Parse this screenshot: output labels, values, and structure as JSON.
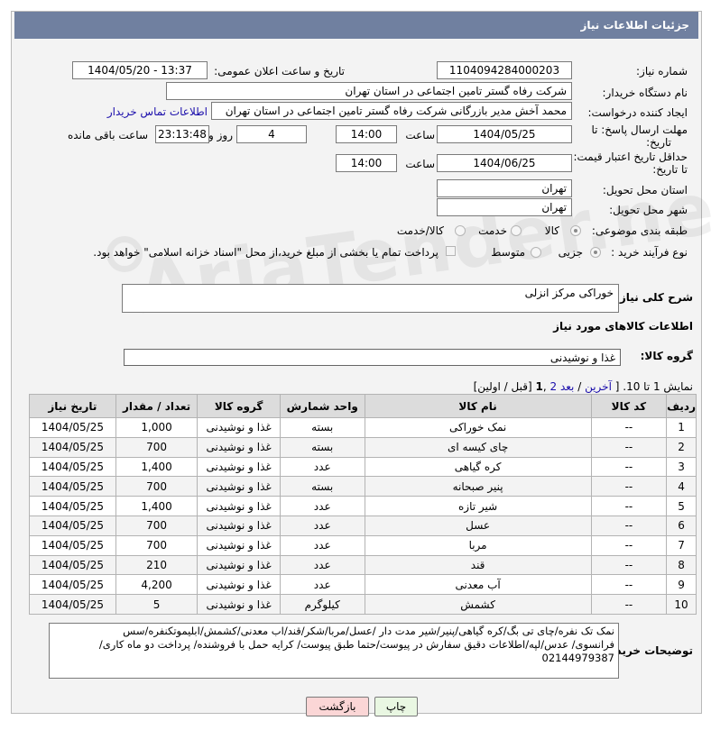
{
  "title": "جزئیات اطلاعات نیاز",
  "need_number": {
    "label": "شماره نیاز:",
    "value": "1104094284000203"
  },
  "announce": {
    "label": "تاریخ و ساعت اعلان عمومی:",
    "value": "1404/05/20 - 13:37"
  },
  "buyer_org": {
    "label": "نام دستگاه خریدار:",
    "value": "شرکت رفاه گستر تامین اجتماعی در استان تهران"
  },
  "creator": {
    "label": "ایجاد کننده درخواست:",
    "value": "محمد آخش مدیر بازرگانی شرکت رفاه گستر تامین اجتماعی در استان تهران",
    "contact_link": "اطلاعات تماس خریدار"
  },
  "deadline": {
    "label1": "مهلت ارسال پاسخ: تا",
    "label2": "تاریخ:",
    "date": "1404/05/25",
    "time_label": "ساعت",
    "time": "14:00",
    "days": "4",
    "days_label": "روز و",
    "remaining": "23:13:48",
    "remaining_label": "ساعت باقی مانده"
  },
  "validity": {
    "label1": "حداقل تاریخ اعتبار قیمت:",
    "label2": "تا تاریخ:",
    "date": "1404/06/25",
    "time_label": "ساعت",
    "time": "14:00"
  },
  "province": {
    "label": "استان محل تحویل:",
    "value": "تهران"
  },
  "city": {
    "label": "شهر محل تحویل:",
    "value": "تهران"
  },
  "category": {
    "label": "طبقه بندی موضوعی:",
    "options": [
      "کالا",
      "خدمت",
      "کالا/خدمت"
    ]
  },
  "process": {
    "label": "نوع فرآیند خرید :",
    "options": [
      "جزیی",
      "متوسط"
    ],
    "payment_note": "پرداخت تمام یا بخشی از مبلغ خرید،از محل \"اسناد خزانه اسلامی\" خواهد بود."
  },
  "summary": {
    "label": "شرح کلی نیاز:",
    "value": "خوراکی مرکز انزلی"
  },
  "goods_info_title": "اطلاعات کالاهای مورد نیاز",
  "goods_group": {
    "label": "گروه کالا:",
    "value": "غذا و نوشیدنی"
  },
  "pagination": {
    "text1": "نمایش 1 تا 10. [",
    "last": "آخرین",
    "sep1": " / ",
    "next": "بعد",
    "page2": "2",
    "page1": "1",
    "text2": "[قبل / اولین]"
  },
  "table": {
    "headers": [
      "ردیف",
      "کد کالا",
      "نام کالا",
      "واحد شمارش",
      "گروه کالا",
      "تعداد / مقدار",
      "تاریخ نیاز"
    ],
    "rows": [
      [
        "1",
        "--",
        "نمک خوراکی",
        "بسته",
        "غذا و نوشیدنی",
        "1,000",
        "1404/05/25"
      ],
      [
        "2",
        "--",
        "چای کیسه ای",
        "بسته",
        "غذا و نوشیدنی",
        "700",
        "1404/05/25"
      ],
      [
        "3",
        "--",
        "کره گیاهی",
        "عدد",
        "غذا و نوشیدنی",
        "1,400",
        "1404/05/25"
      ],
      [
        "4",
        "--",
        "پنیر صبحانه",
        "بسته",
        "غذا و نوشیدنی",
        "700",
        "1404/05/25"
      ],
      [
        "5",
        "--",
        "شیر تازه",
        "عدد",
        "غذا و نوشیدنی",
        "1,400",
        "1404/05/25"
      ],
      [
        "6",
        "--",
        "عسل",
        "عدد",
        "غذا و نوشیدنی",
        "700",
        "1404/05/25"
      ],
      [
        "7",
        "--",
        "مربا",
        "عدد",
        "غذا و نوشیدنی",
        "700",
        "1404/05/25"
      ],
      [
        "8",
        "--",
        "قند",
        "عدد",
        "غذا و نوشیدنی",
        "210",
        "1404/05/25"
      ],
      [
        "9",
        "--",
        "آب معدنی",
        "عدد",
        "غذا و نوشیدنی",
        "4,200",
        "1404/05/25"
      ],
      [
        "10",
        "--",
        "کشمش",
        "کیلوگرم",
        "غذا و نوشیدنی",
        "5",
        "1404/05/25"
      ]
    ]
  },
  "buyer_notes": {
    "label": "توضیحات خریدار:",
    "line1": "نمک تک نفره/چای تی بگ/کره گیاهی/پنیر/شیر مدت دار /عسل/مربا/شکر/قند/اب معدنی/کشمش/ابلیموتکنفره/سس",
    "line2": "فرانسوی/ عدس/لپه/اطلاعات دقیق سفارش در پیوست/حتما طبق پیوست/ کرایه حمل با فروشنده/ پرداخت دو ماه کاری/",
    "line3": "02144979387"
  },
  "buttons": {
    "print": "چاپ",
    "back": "بازگشت"
  },
  "colors": {
    "titlebar": "#7080a0",
    "back_button": "#fbd6d6",
    "print_button": "#e9f7e2"
  }
}
